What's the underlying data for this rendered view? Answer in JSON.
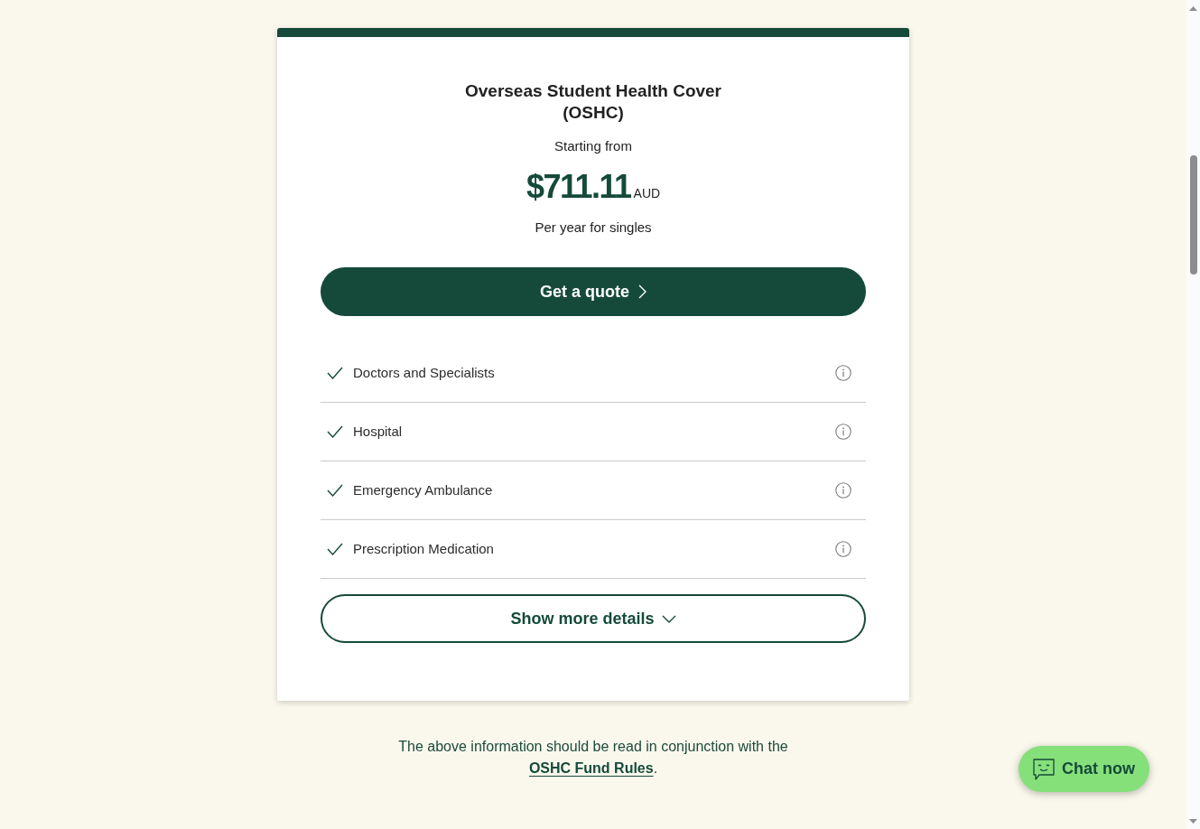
{
  "plan_card": {
    "title": "Overseas Student Health Cover (OSHC)",
    "price_intro": "Starting from",
    "price": "$711.11",
    "currency": "AUD",
    "price_note": "Per year for singles",
    "quote_button": {
      "label": "Get a quote"
    },
    "benefits": [
      {
        "label": "Doctors and Specialists",
        "included": true
      },
      {
        "label": "Hospital",
        "included": true
      },
      {
        "label": "Emergency Ambulance",
        "included": true
      },
      {
        "label": "Prescription Medication",
        "included": true
      }
    ],
    "details_toggle": {
      "label": "Show more details",
      "expanded": false
    }
  },
  "disclaimer": {
    "text_before": "The above information should be read in conjunction with the",
    "link": "OSHC Fund Rules",
    "text_after": "."
  },
  "chat_button": {
    "label": "Chat now"
  }
}
